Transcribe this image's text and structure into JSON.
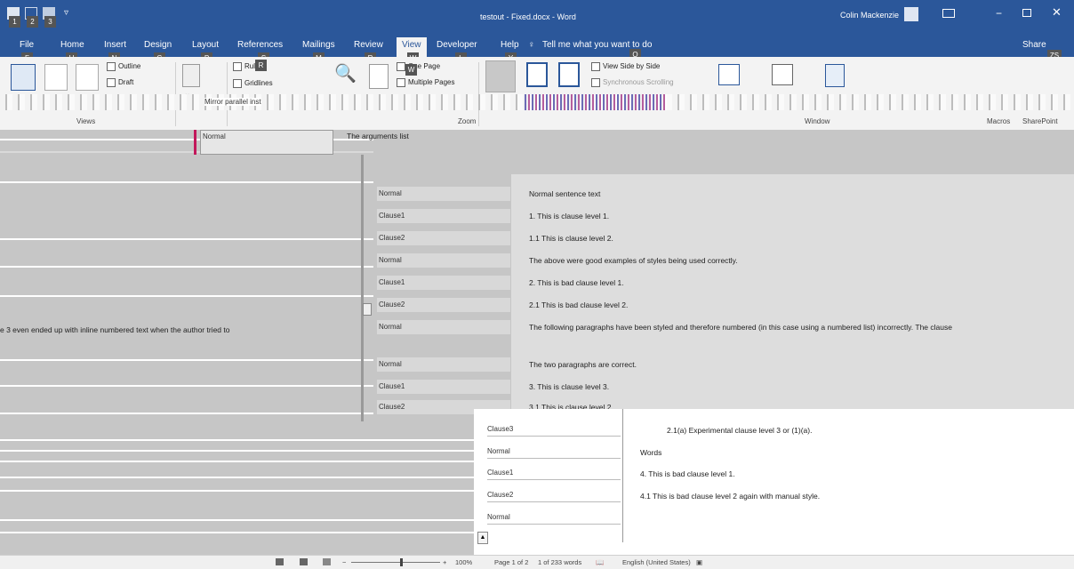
{
  "titlebar": {
    "title": "testout - Fixed.docx - Word",
    "user": "Colin Mackenzie",
    "qat_keytips": [
      "1",
      "2",
      "3"
    ]
  },
  "tabs": [
    {
      "label": "File",
      "keytip": "F"
    },
    {
      "label": "Home",
      "keytip": "H"
    },
    {
      "label": "Insert",
      "keytip": "N"
    },
    {
      "label": "Design",
      "keytip": "G"
    },
    {
      "label": "Layout",
      "keytip": "P"
    },
    {
      "label": "References",
      "keytip": "S"
    },
    {
      "label": "Mailings",
      "keytip": "M"
    },
    {
      "label": "Review",
      "keytip": "R"
    },
    {
      "label": "View",
      "keytip": "W"
    },
    {
      "label": "Developer",
      "keytip": "L"
    },
    {
      "label": "Help",
      "keytip": "Y"
    }
  ],
  "tell_me": {
    "text": "Tell me what you want to do",
    "keytip": "Q"
  },
  "share": {
    "label": "Share",
    "keytip": "ZS"
  },
  "ribbon": {
    "views": {
      "outline": "Outline",
      "draft": "Draft",
      "group": "Views"
    },
    "show": {
      "ruler": "Ruler",
      "gridlines": "Gridlines",
      "ruler_keytip": "R"
    },
    "zoom": {
      "one_page": "One Page",
      "multiple_pages": "Multiple Pages",
      "group": "Zoom"
    },
    "window": {
      "view_side_by_side": "View Side by Side",
      "sync_scrolling": "Synchronous Scrolling",
      "group": "Window"
    },
    "macros_group": "Macros",
    "sharepoint_group": "SharePoint"
  },
  "doc": {
    "top_style": "Normal",
    "top_text": "The arguments list",
    "left_line": "e 3 even ended up with inline numbered text when the author tried to",
    "rows": [
      {
        "style": "Normal",
        "text": "Normal sentence text"
      },
      {
        "style": "Clause1",
        "text": "1.   This is clause level 1."
      },
      {
        "style": "Clause2",
        "text": "1.1       This is clause level 2."
      },
      {
        "style": "Normal",
        "text": "The above were good examples of styles being used correctly."
      },
      {
        "style": "Clause1",
        "text": "2.   This is bad clause level 1."
      },
      {
        "style": "Clause2",
        "text": "2.1       This is bad clause level 2."
      },
      {
        "style": "Normal",
        "text": "The following paragraphs have been styled and therefore numbered (in this case using a numbered list) incorrectly. The clause"
      },
      {
        "style": "Normal",
        "text": "The two paragraphs are correct."
      },
      {
        "style": "Clause1",
        "text": "3.   This is clause level 3."
      },
      {
        "style": "Clause2",
        "text": "3.1       This is clause level 2."
      }
    ],
    "page2_rows": [
      {
        "style": "Clause3",
        "text": "2.1(a)       Experimental clause level 3 or (1)(a)."
      },
      {
        "style": "Normal",
        "text": "Words"
      },
      {
        "style": "Clause1",
        "text": "4.   This is bad clause level 1."
      },
      {
        "style": "Clause2",
        "text": "4.1       This is bad clause level 2 again with manual style."
      },
      {
        "style": "Normal",
        "text": ""
      }
    ]
  },
  "status": {
    "page": "Page 1 of 2",
    "words": "1 of 233 words",
    "language": "English (United States)",
    "zoom": "100%"
  }
}
